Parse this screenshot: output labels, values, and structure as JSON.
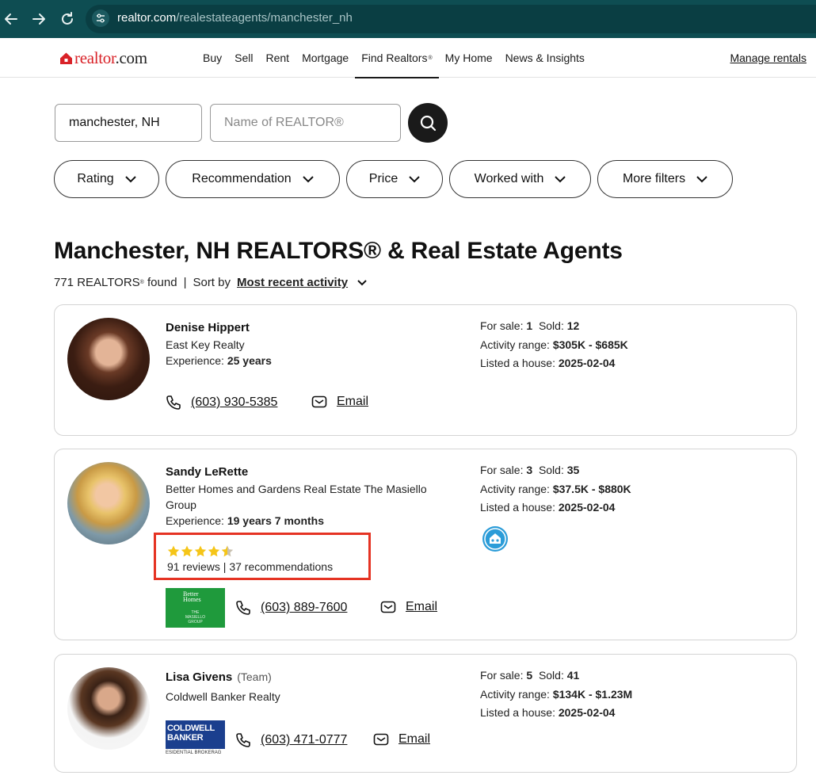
{
  "browser": {
    "url_host": "realtor.com",
    "url_path": "/realestateagents/manchester_nh"
  },
  "header": {
    "logo": "realtor.com",
    "nav": [
      {
        "label": "Buy",
        "active": false
      },
      {
        "label": "Sell",
        "active": false
      },
      {
        "label": "Rent",
        "active": false
      },
      {
        "label": "Mortgage",
        "active": false
      },
      {
        "label": "Find Realtors",
        "sup": "®",
        "active": true
      },
      {
        "label": "My Home",
        "active": false
      },
      {
        "label": "News & Insights",
        "active": false
      }
    ],
    "manage_rentals": "Manage rentals"
  },
  "search": {
    "location_value": "manchester, NH",
    "name_placeholder": "Name of REALTOR®"
  },
  "filters": [
    "Rating",
    "Recommendation",
    "Price",
    "Worked with",
    "More filters"
  ],
  "results": {
    "title": "Manchester, NH REALTORS® & Real Estate Agents",
    "count_prefix": "771 REALTORS",
    "count_sup": "®",
    "count_suffix": "found",
    "sort_label": "Sort by",
    "sort_value": "Most recent activity"
  },
  "agents": [
    {
      "name": "Denise Hippert",
      "team": "",
      "brokerage": "East Key Realty",
      "experience_label": "Experience:",
      "experience": "25 years",
      "for_sale_label": "For sale:",
      "for_sale": "1",
      "sold_label": "Sold:",
      "sold": "12",
      "range_label": "Activity range:",
      "range": "$305K - $685K",
      "listed_label": "Listed a house:",
      "listed": "2025-02-04",
      "phone": "(603) 930-5385",
      "email_label": "Email"
    },
    {
      "name": "Sandy LeRette",
      "team": "",
      "brokerage": "Better Homes and Gardens Real Estate The Masiello Group",
      "experience_label": "Experience:",
      "experience": "19 years 7 months",
      "rating": 4.5,
      "reviews": "91 reviews | 37 recommendations",
      "for_sale_label": "For sale:",
      "for_sale": "3",
      "sold_label": "Sold:",
      "sold": "35",
      "range_label": "Activity range:",
      "range": "$37.5K - $880K",
      "listed_label": "Listed a house:",
      "listed": "2025-02-04",
      "phone": "(603) 889-7600",
      "email_label": "Email",
      "broker_logo": {
        "line1": "Better",
        "line2": "Homes",
        "line3": "THE",
        "line4": "MASIELLO",
        "line5": "GROUP"
      }
    },
    {
      "name": "Lisa Givens",
      "team": "(Team)",
      "brokerage": "Coldwell Banker Realty",
      "for_sale_label": "For sale:",
      "for_sale": "5",
      "sold_label": "Sold:",
      "sold": "41",
      "range_label": "Activity range:",
      "range": "$134K - $1.23M",
      "listed_label": "Listed a house:",
      "listed": "2025-02-04",
      "phone": "(603) 471-0777",
      "email_label": "Email",
      "broker_logo": {
        "line1": "COLDWELL",
        "line2": "BANKER",
        "line3": "ESIDENTIAL BROKERAG"
      }
    }
  ],
  "colors": {
    "browser_bar": "#0e4d52",
    "brand_red": "#d92228",
    "highlight_box": "#e53323",
    "star": "#f5c518",
    "bhg_green": "#1f9a3c",
    "coldwell_blue": "#1b3f8e"
  },
  "icons": [
    "back-arrow-icon",
    "forward-arrow-icon",
    "reload-icon",
    "site-settings-icon",
    "realtor-house-icon",
    "search-icon",
    "chevron-down-icon",
    "phone-icon",
    "email-icon",
    "star-icon",
    "community-badge-icon"
  ]
}
